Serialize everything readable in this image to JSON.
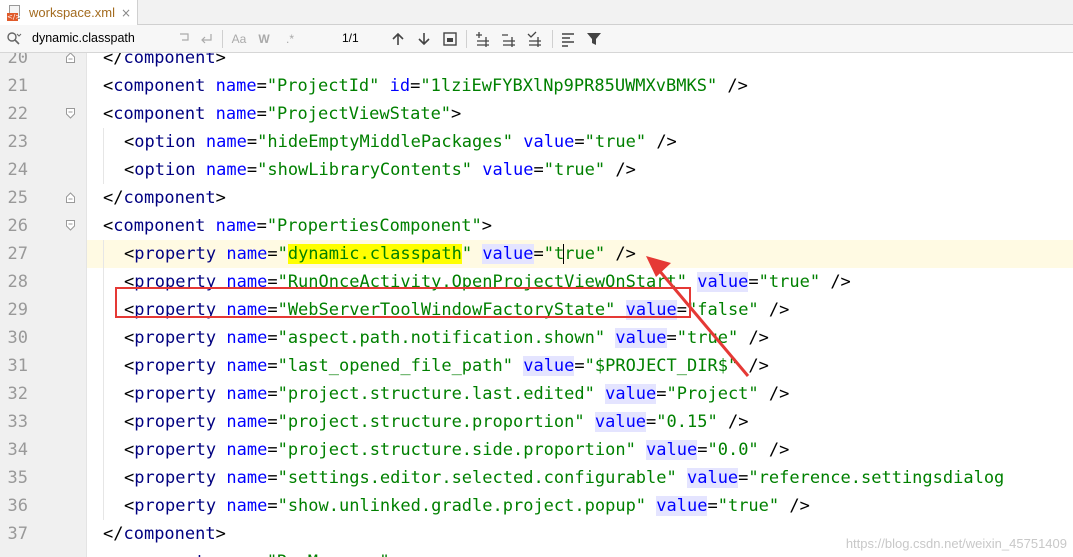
{
  "tab": {
    "filename": "workspace.xml",
    "file_badge": "</>",
    "close": "×"
  },
  "search": {
    "query": "dynamic.classpath",
    "match_case": "Aa",
    "words": "W",
    "regex": ".*",
    "result_count": "1/1"
  },
  "editor": {
    "lines": [
      {
        "num": "20",
        "tokens": [
          {
            "c": "p",
            "t": "</"
          },
          {
            "c": "t",
            "t": "component"
          },
          {
            "c": "p",
            "t": ">"
          }
        ],
        "indent": 0
      },
      {
        "num": "21",
        "tokens": [
          {
            "c": "p",
            "t": "<"
          },
          {
            "c": "t",
            "t": "component "
          },
          {
            "c": "a",
            "t": "name"
          },
          {
            "c": "p",
            "t": "="
          },
          {
            "c": "v",
            "t": "\"ProjectId\" "
          },
          {
            "c": "a",
            "t": "id"
          },
          {
            "c": "p",
            "t": "="
          },
          {
            "c": "v",
            "t": "\"1lziEwFYBXlNp9PR85UWMXvBMKS\" "
          },
          {
            "c": "p",
            "t": "/>"
          }
        ],
        "indent": 0
      },
      {
        "num": "22",
        "tokens": [
          {
            "c": "p",
            "t": "<"
          },
          {
            "c": "t",
            "t": "component "
          },
          {
            "c": "a",
            "t": "name"
          },
          {
            "c": "p",
            "t": "="
          },
          {
            "c": "v",
            "t": "\"ProjectViewState\""
          },
          {
            "c": "p",
            "t": ">"
          }
        ],
        "indent": 0
      },
      {
        "num": "23",
        "tokens": [
          {
            "c": "p",
            "t": "<"
          },
          {
            "c": "t",
            "t": "option "
          },
          {
            "c": "a",
            "t": "name"
          },
          {
            "c": "p",
            "t": "="
          },
          {
            "c": "v",
            "t": "\"hideEmptyMiddlePackages\" "
          },
          {
            "c": "a",
            "t": "value"
          },
          {
            "c": "p",
            "t": "="
          },
          {
            "c": "v",
            "t": "\"true\" "
          },
          {
            "c": "p",
            "t": "/>"
          }
        ],
        "indent": 1
      },
      {
        "num": "24",
        "tokens": [
          {
            "c": "p",
            "t": "<"
          },
          {
            "c": "t",
            "t": "option "
          },
          {
            "c": "a",
            "t": "name"
          },
          {
            "c": "p",
            "t": "="
          },
          {
            "c": "v",
            "t": "\"showLibraryContents\" "
          },
          {
            "c": "a",
            "t": "value"
          },
          {
            "c": "p",
            "t": "="
          },
          {
            "c": "v",
            "t": "\"true\" "
          },
          {
            "c": "p",
            "t": "/>"
          }
        ],
        "indent": 1
      },
      {
        "num": "25",
        "tokens": [
          {
            "c": "p",
            "t": "</"
          },
          {
            "c": "t",
            "t": "component"
          },
          {
            "c": "p",
            "t": ">"
          }
        ],
        "indent": 0
      },
      {
        "num": "26",
        "tokens": [
          {
            "c": "p",
            "t": "<"
          },
          {
            "c": "t",
            "t": "component "
          },
          {
            "c": "a",
            "t": "name"
          },
          {
            "c": "p",
            "t": "="
          },
          {
            "c": "v",
            "t": "\"PropertiesComponent\""
          },
          {
            "c": "p",
            "t": ">"
          }
        ],
        "indent": 0
      },
      {
        "num": "27",
        "tokens": [
          {
            "c": "p",
            "t": "<"
          },
          {
            "c": "t",
            "t": "property "
          },
          {
            "c": "a",
            "t": "name"
          },
          {
            "c": "p",
            "t": "="
          },
          {
            "c": "v",
            "t": "\""
          },
          {
            "c": "v shl",
            "t": "dynamic.classpath"
          },
          {
            "c": "v",
            "t": "\" "
          },
          {
            "c": "a ahl",
            "t": "value"
          },
          {
            "c": "p",
            "t": "="
          },
          {
            "c": "v",
            "t": "\"true\" "
          },
          {
            "c": "p",
            "t": "/>"
          }
        ],
        "indent": 1,
        "current": true
      },
      {
        "num": "28",
        "tokens": [
          {
            "c": "p",
            "t": "<"
          },
          {
            "c": "t",
            "t": "property "
          },
          {
            "c": "a",
            "t": "name"
          },
          {
            "c": "p",
            "t": "="
          },
          {
            "c": "v",
            "t": "\"RunOnceActivity.OpenProjectViewOnStart\" "
          },
          {
            "c": "a ahl",
            "t": "value"
          },
          {
            "c": "p",
            "t": "="
          },
          {
            "c": "v",
            "t": "\"true\" "
          },
          {
            "c": "p",
            "t": "/>"
          }
        ],
        "indent": 1
      },
      {
        "num": "29",
        "tokens": [
          {
            "c": "p",
            "t": "<"
          },
          {
            "c": "t",
            "t": "property "
          },
          {
            "c": "a",
            "t": "name"
          },
          {
            "c": "p",
            "t": "="
          },
          {
            "c": "v",
            "t": "\"WebServerToolWindowFactoryState\" "
          },
          {
            "c": "a ahl",
            "t": "value"
          },
          {
            "c": "p",
            "t": "="
          },
          {
            "c": "v",
            "t": "\"false\" "
          },
          {
            "c": "p",
            "t": "/>"
          }
        ],
        "indent": 1
      },
      {
        "num": "30",
        "tokens": [
          {
            "c": "p",
            "t": "<"
          },
          {
            "c": "t",
            "t": "property "
          },
          {
            "c": "a",
            "t": "name"
          },
          {
            "c": "p",
            "t": "="
          },
          {
            "c": "v",
            "t": "\"aspect.path.notification.shown\" "
          },
          {
            "c": "a ahl",
            "t": "value"
          },
          {
            "c": "p",
            "t": "="
          },
          {
            "c": "v",
            "t": "\"true\" "
          },
          {
            "c": "p",
            "t": "/>"
          }
        ],
        "indent": 1
      },
      {
        "num": "31",
        "tokens": [
          {
            "c": "p",
            "t": "<"
          },
          {
            "c": "t",
            "t": "property "
          },
          {
            "c": "a",
            "t": "name"
          },
          {
            "c": "p",
            "t": "="
          },
          {
            "c": "v",
            "t": "\"last_opened_file_path\" "
          },
          {
            "c": "a ahl",
            "t": "value"
          },
          {
            "c": "p",
            "t": "="
          },
          {
            "c": "v",
            "t": "\"$PROJECT_DIR$\" "
          },
          {
            "c": "p",
            "t": "/>"
          }
        ],
        "indent": 1
      },
      {
        "num": "32",
        "tokens": [
          {
            "c": "p",
            "t": "<"
          },
          {
            "c": "t",
            "t": "property "
          },
          {
            "c": "a",
            "t": "name"
          },
          {
            "c": "p",
            "t": "="
          },
          {
            "c": "v",
            "t": "\"project.structure.last.edited\" "
          },
          {
            "c": "a ahl",
            "t": "value"
          },
          {
            "c": "p",
            "t": "="
          },
          {
            "c": "v",
            "t": "\"Project\" "
          },
          {
            "c": "p",
            "t": "/>"
          }
        ],
        "indent": 1
      },
      {
        "num": "33",
        "tokens": [
          {
            "c": "p",
            "t": "<"
          },
          {
            "c": "t",
            "t": "property "
          },
          {
            "c": "a",
            "t": "name"
          },
          {
            "c": "p",
            "t": "="
          },
          {
            "c": "v",
            "t": "\"project.structure.proportion\" "
          },
          {
            "c": "a ahl",
            "t": "value"
          },
          {
            "c": "p",
            "t": "="
          },
          {
            "c": "v",
            "t": "\"0.15\" "
          },
          {
            "c": "p",
            "t": "/>"
          }
        ],
        "indent": 1
      },
      {
        "num": "34",
        "tokens": [
          {
            "c": "p",
            "t": "<"
          },
          {
            "c": "t",
            "t": "property "
          },
          {
            "c": "a",
            "t": "name"
          },
          {
            "c": "p",
            "t": "="
          },
          {
            "c": "v",
            "t": "\"project.structure.side.proportion\" "
          },
          {
            "c": "a ahl",
            "t": "value"
          },
          {
            "c": "p",
            "t": "="
          },
          {
            "c": "v",
            "t": "\"0.0\" "
          },
          {
            "c": "p",
            "t": "/>"
          }
        ],
        "indent": 1
      },
      {
        "num": "35",
        "tokens": [
          {
            "c": "p",
            "t": "<"
          },
          {
            "c": "t",
            "t": "property "
          },
          {
            "c": "a",
            "t": "name"
          },
          {
            "c": "p",
            "t": "="
          },
          {
            "c": "v",
            "t": "\"settings.editor.selected.configurable\" "
          },
          {
            "c": "a ahl",
            "t": "value"
          },
          {
            "c": "p",
            "t": "="
          },
          {
            "c": "v",
            "t": "\"reference.settingsdialog"
          }
        ],
        "indent": 1
      },
      {
        "num": "36",
        "tokens": [
          {
            "c": "p",
            "t": "<"
          },
          {
            "c": "t",
            "t": "property "
          },
          {
            "c": "a",
            "t": "name"
          },
          {
            "c": "p",
            "t": "="
          },
          {
            "c": "v",
            "t": "\"show.unlinked.gradle.project.popup\" "
          },
          {
            "c": "a ahl",
            "t": "value"
          },
          {
            "c": "p",
            "t": "="
          },
          {
            "c": "v",
            "t": "\"true\" "
          },
          {
            "c": "p",
            "t": "/>"
          }
        ],
        "indent": 1
      },
      {
        "num": "37",
        "tokens": [
          {
            "c": "p",
            "t": "</"
          },
          {
            "c": "t",
            "t": "component"
          },
          {
            "c": "p",
            "t": ">"
          }
        ],
        "indent": 0
      },
      {
        "num": "",
        "tokens": [
          {
            "c": "p",
            "t": "<"
          },
          {
            "c": "t",
            "t": "component "
          },
          {
            "c": "a",
            "t": "name"
          },
          {
            "c": "p",
            "t": "="
          },
          {
            "c": "v",
            "t": "\"RunManager\""
          },
          {
            "c": "p",
            "t": ">"
          }
        ],
        "indent": 0
      }
    ]
  },
  "watermark": "https://blog.csdn.net/weixin_45751409",
  "colors": {
    "annotation": "#e53935",
    "search_match": "#ffff00",
    "tag": "#000080",
    "attr": "#0000ff",
    "string": "#008000"
  }
}
